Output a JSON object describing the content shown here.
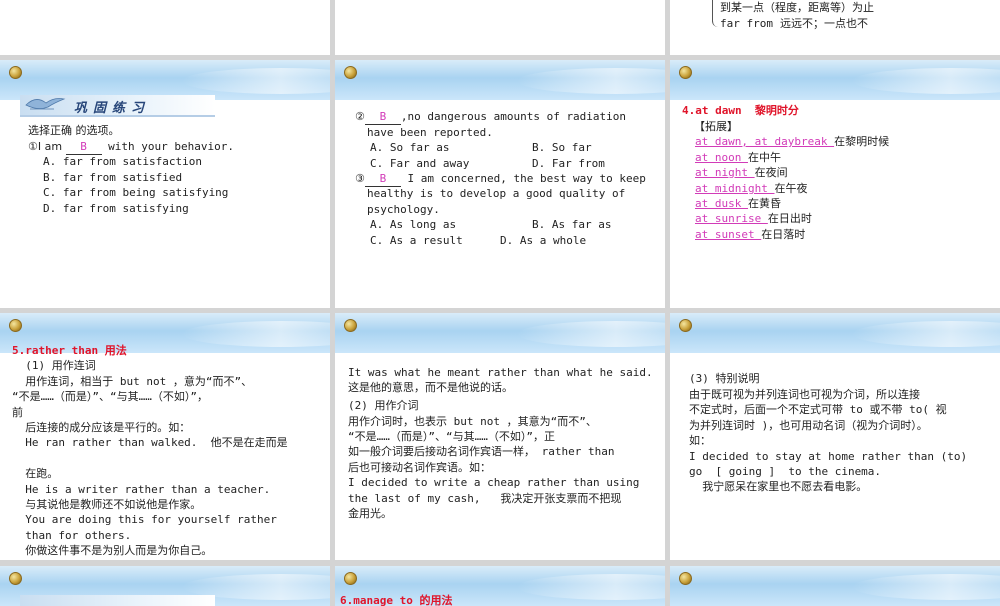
{
  "slide_top_right": {
    "line1": "到某一点（程度，距离等）为止",
    "line2_en": "far from",
    "line2_cn": "  远远不；一点也不"
  },
  "slide_mid_left": {
    "header_label": "巩固练习",
    "instruction": "选择正确 的选项。",
    "q1_prefix": "①I am ",
    "q1_answer": "B",
    "q1_suffix": " with your behavior.",
    "q1_options": [
      "A. far from satisfaction",
      "B. far from satisfied",
      "C. far from being satisfying",
      "D. far from satisfying"
    ]
  },
  "slide_mid_center": {
    "q2_prefix": "②",
    "q2_answer": "B",
    "q2_suffix": ",no dangerous amounts of radiation",
    "q2_line2": "have been reported.",
    "q2_opt_a": "A. So far as",
    "q2_opt_b": "B. So far",
    "q2_opt_c": "C. Far and away",
    "q2_opt_d": "D. Far from",
    "q3_prefix": "③",
    "q3_answer": "B",
    "q3_suffix": " I am concerned, the best way to keep",
    "q3_line2": "healthy is to develop a good quality of",
    "q3_line3": "psychology.",
    "q3_opt_a": "A. As long as",
    "q3_opt_b": "B. As far as",
    "q3_opt_c": "C. As a result",
    "q3_opt_d": "D. As a whole"
  },
  "slide_mid_right": {
    "heading": "4.at dawn  黎明时分",
    "expand_label": "【拓展】",
    "phrases": [
      {
        "en": "at dawn, at daybreak ",
        "cn": "在黎明时候"
      },
      {
        "en": "at noon ",
        "cn": "在中午"
      },
      {
        "en": "at night ",
        "cn": "在夜间"
      },
      {
        "en": "at midnight ",
        "cn": "在午夜"
      },
      {
        "en": "at dusk ",
        "cn": "在黄昏"
      },
      {
        "en": "at sunrise ",
        "cn": "在日出时"
      },
      {
        "en": "at sunset ",
        "cn": "在日落时"
      }
    ]
  },
  "slide_bot_left": {
    "heading": "5.rather than 用法",
    "lines": [
      "  (1) 用作连词",
      "  用作连词，相当于 but not ，意为“而不”、",
      "“不是……（而是）”、“与其……（不如）”，",
      "前",
      "  后连接的成分应该是平行的。如：",
      "  He ran rather than walked.  他不是在走而是",
      "",
      "  在跑。",
      "  He is a writer rather than a teacher.",
      "  与其说他是教师还不如说他是作家。",
      "  You are doing this for yourself rather",
      "  than for others.",
      "  你做这件事不是为别人而是为你自己。"
    ]
  },
  "slide_bot_center": {
    "lines": [
      "It was what he meant rather than what he said.",
      "这是他的意思，而不是他说的话。",
      "(2) 用作介词",
      "用作介词时，也表示 but not ，其意为“而不”、",
      "“不是……（而是）”、“与其……（不如）”，正",
      "如一般介词要后接动名词作宾语一样， rather than",
      "后也可接动名词作宾语。如：",
      "I decided to write a cheap rather than using",
      "the last of my cash,   我决定开张支票而不把现",
      "金用光。"
    ]
  },
  "slide_bot_right": {
    "lines": [
      "(3) 特别说明",
      "由于既可视为并列连词也可视为介词，所以连接",
      "不定式时，后面一个不定式可带 to 或不带 to( 视",
      "为并列连词时 )，也可用动名词（视为介词时）。",
      "如：",
      "I decided to stay at home rather than (to)",
      "go  [ going ]  to the cinema.",
      "  我宁愿呆在家里也不愿去看电影。"
    ]
  },
  "slide_last_center": {
    "heading_partial": "6.manage to 的用法"
  },
  "colors": {
    "heading_red": "#e0142a",
    "answer_pink": "#d23bb8",
    "band_blue": "#a9d3f1"
  }
}
